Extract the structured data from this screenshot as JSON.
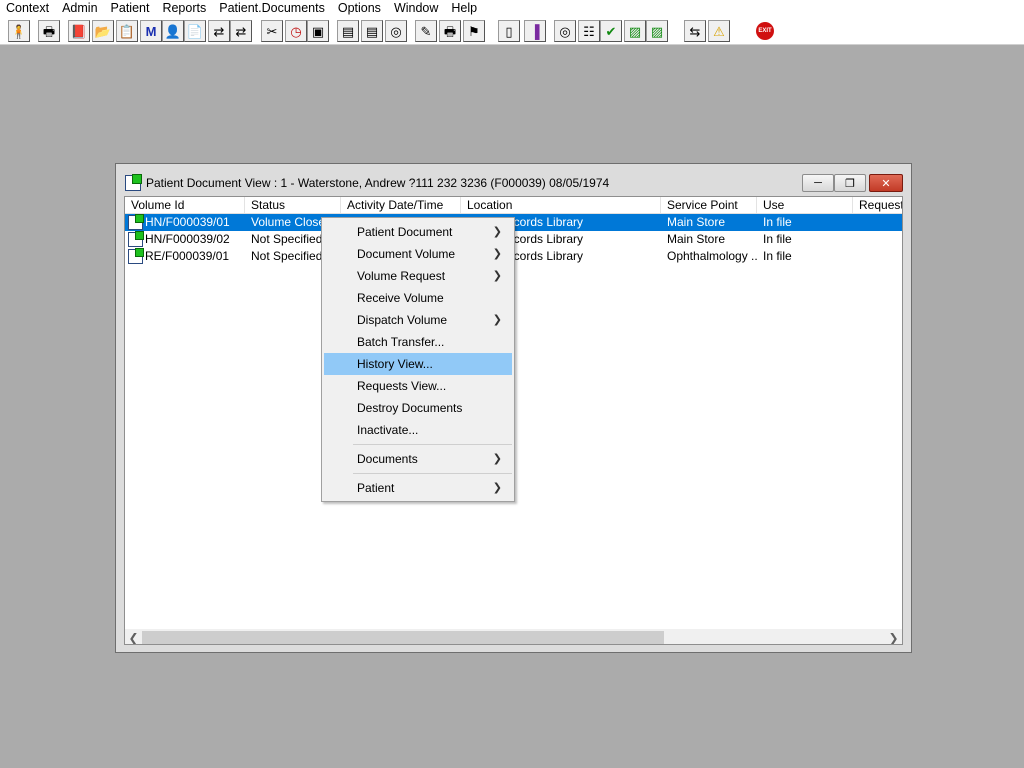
{
  "menubar": [
    "Context",
    "Admin",
    "Patient",
    "Reports",
    "Patient.Documents",
    "Options",
    "Window",
    "Help"
  ],
  "toolbar": {
    "icons": [
      "patient-icon",
      "printer-icon",
      "book-icon",
      "folder-icon",
      "report-icon",
      "mail-icon",
      "person-icon",
      "document-icon",
      "transfer-icon",
      "transfer-icon",
      "scan-icon",
      "clock-icon",
      "monitor-icon",
      "card-icon",
      "card-icon",
      "globe-icon",
      "notes-icon",
      "printer-icon",
      "user-chart-icon",
      "page-icon",
      "chart-icon",
      "globe-icon",
      "forms-icon",
      "check-icon",
      "volume-icon",
      "volume-icon",
      "swap-icon",
      "warning-icon",
      "exit-icon"
    ],
    "exit_label": "EXIT"
  },
  "window": {
    "title": "Patient Document View : 1 - Waterstone, Andrew ?111 232 3236 (F000039) 08/05/1974",
    "columns": [
      "Volume Id",
      "Status",
      "Activity Date/Time",
      "Location",
      "Service Point",
      "Use",
      "Requeste"
    ],
    "rows": [
      {
        "volume_id": "HN/F000039/01",
        "status": "Volume Closed",
        "activity": "",
        "location": "ecords Library",
        "service_point": "Main Store",
        "use": "In file",
        "selected": true
      },
      {
        "volume_id": "HN/F000039/02",
        "status": "Not Specified",
        "activity": "",
        "location": "ecords Library",
        "service_point": "Main Store",
        "use": "In file",
        "selected": false
      },
      {
        "volume_id": "RE/F000039/01",
        "status": "Not Specified",
        "activity": "",
        "location": "ecords Library",
        "service_point": "Ophthalmology ...",
        "use": "In file",
        "selected": false
      }
    ]
  },
  "context_menu": {
    "items": [
      {
        "label": "Patient Document",
        "submenu": true
      },
      {
        "label": "Document Volume",
        "submenu": true
      },
      {
        "label": "Volume Request",
        "submenu": true
      },
      {
        "label": "Receive Volume",
        "submenu": false
      },
      {
        "label": "Dispatch Volume",
        "submenu": true
      },
      {
        "label": "Batch Transfer...",
        "submenu": false
      },
      {
        "label": "History View...",
        "submenu": false,
        "highlighted": true
      },
      {
        "label": "Requests View...",
        "submenu": false
      },
      {
        "label": "Destroy Documents",
        "submenu": false
      },
      {
        "label": "Inactivate...",
        "submenu": false
      },
      {
        "label": "Documents",
        "submenu": true
      },
      {
        "label": "Patient",
        "submenu": true
      }
    ]
  },
  "colors": {
    "selection": "#0078d7",
    "menu_highlight": "#91c9f7",
    "desktop": "#ababab"
  }
}
